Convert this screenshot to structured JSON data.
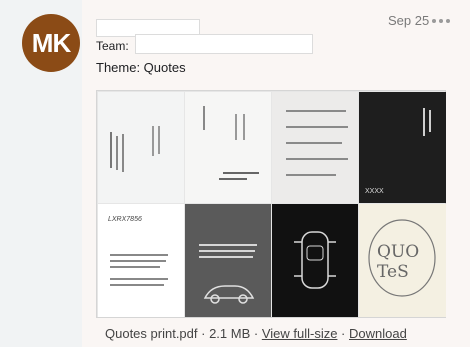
{
  "message": {
    "avatar_initials": "MK",
    "date": "Sep 25",
    "team_label": "Team:",
    "theme_label": "Theme: Quotes"
  },
  "attachment": {
    "filename": "Quotes print.pdf",
    "separator": " · ",
    "size": "2.1 MB",
    "view_label": "View full-size",
    "download_label": "Download"
  },
  "preview_tiles": {
    "tile4_label": "XXXX",
    "tile5_title": "LXRX7856",
    "tile8_text": "QUOTeS"
  },
  "colors": {
    "avatar_bg": "#8b4b16",
    "card_bg": "#faf6f4"
  }
}
